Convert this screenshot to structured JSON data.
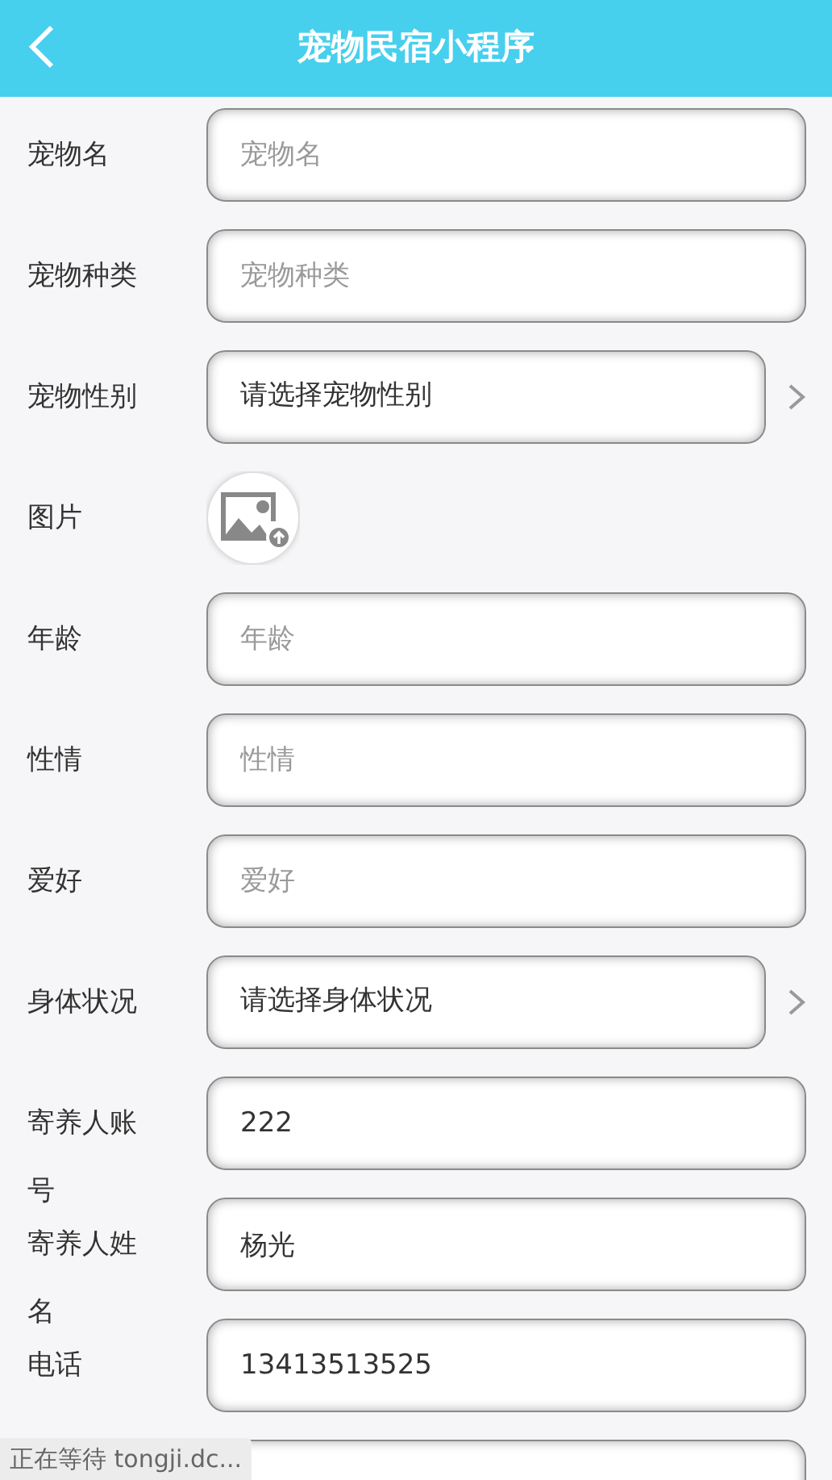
{
  "header": {
    "title": "宠物民宿小程序"
  },
  "fields": [
    {
      "kind": "input",
      "label": "宠物名",
      "placeholder": "宠物名"
    },
    {
      "kind": "input",
      "label": "宠物种类",
      "placeholder": "宠物种类"
    },
    {
      "kind": "select",
      "label": "宠物性别",
      "text": "请选择宠物性别"
    },
    {
      "kind": "image",
      "label": "图片"
    },
    {
      "kind": "input",
      "label": "年龄",
      "placeholder": "年龄"
    },
    {
      "kind": "input",
      "label": "性情",
      "placeholder": "性情"
    },
    {
      "kind": "input",
      "label": "爱好",
      "placeholder": "爱好"
    },
    {
      "kind": "select",
      "label": "身体状况",
      "text": "请选择身体状况"
    },
    {
      "kind": "input",
      "label": "寄养人账号",
      "value": "222"
    },
    {
      "kind": "input",
      "label": "寄养人姓名",
      "value": "杨光"
    },
    {
      "kind": "input",
      "label": "电话",
      "value": "13413513525"
    },
    {
      "kind": "input"
    }
  ],
  "status_bar": {
    "text": "正在等待 tongji.dc..."
  }
}
